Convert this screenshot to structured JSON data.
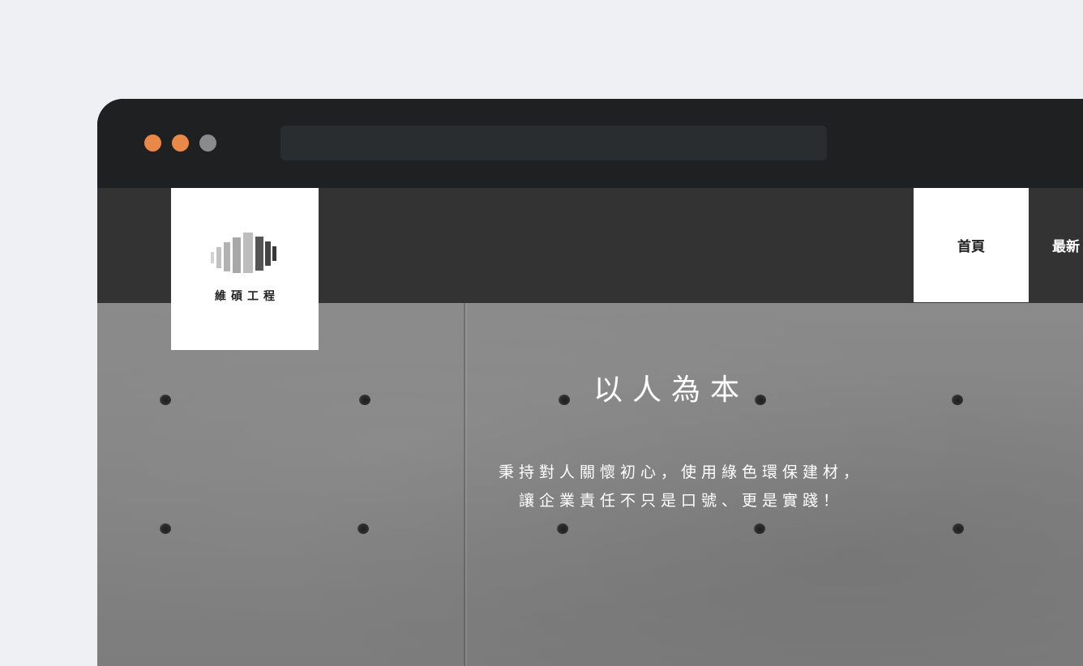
{
  "browser": {
    "window_controls": [
      "close",
      "minimize",
      "maximize"
    ],
    "colors": {
      "close": "#e8894a",
      "minimize": "#e8894a",
      "maximize": "#8a8c8c"
    }
  },
  "site": {
    "logo_text": "維碩工程",
    "logo_icon": "building-bars-icon"
  },
  "nav": {
    "items": [
      {
        "label": "首頁",
        "active": true
      },
      {
        "label": "最新"
      }
    ]
  },
  "hero": {
    "title": "以人為本",
    "line1": "秉持對人關懷初心，使用綠色環保建材，",
    "line2": "讓企業責任不只是口號、更是實踐！"
  }
}
